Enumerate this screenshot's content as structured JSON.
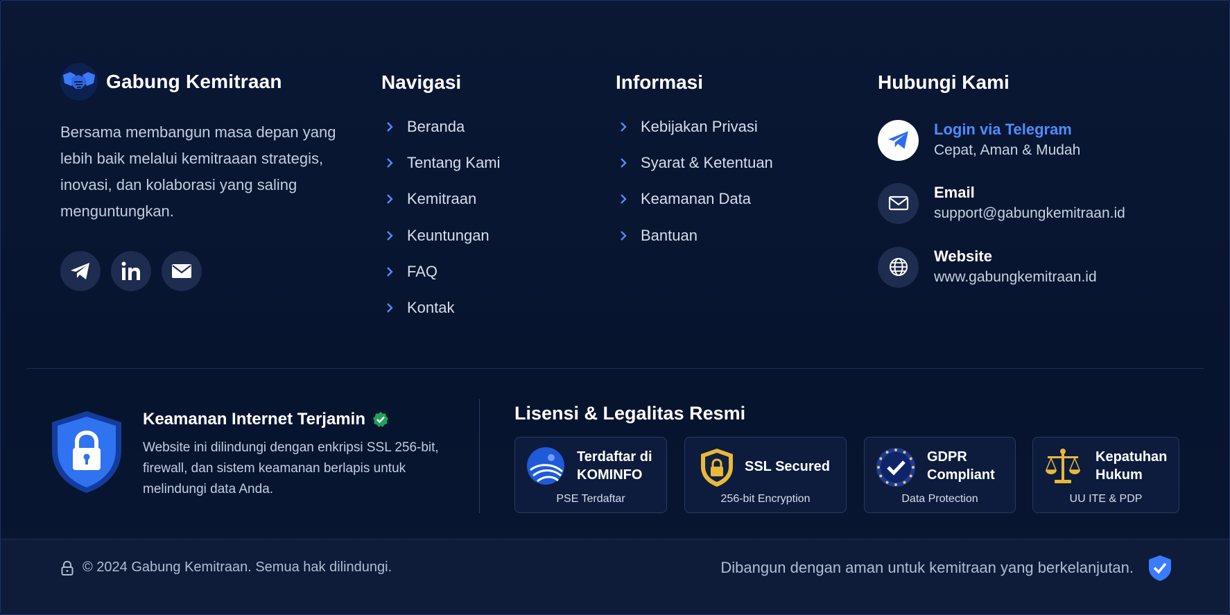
{
  "brand": {
    "name": "Gabung Kemitraan",
    "description": "Bersama membangun masa depan yang lebih baik melalui kemitraaan strategis, inovasi, dan kolaborasi yang saling menguntungkan.",
    "social": [
      "telegram-icon",
      "linkedin-icon",
      "mail-icon"
    ]
  },
  "navigasi": {
    "title": "Navigasi",
    "items": [
      {
        "label": "Beranda"
      },
      {
        "label": "Tentang Kami"
      },
      {
        "label": "Kemitraan"
      },
      {
        "label": "Keuntungan"
      },
      {
        "label": "FAQ"
      },
      {
        "label": "Kontak"
      }
    ]
  },
  "informasi": {
    "title": "Informasi",
    "items": [
      {
        "label": "Kebijakan Privasi"
      },
      {
        "label": "Syarat & Ketentuan"
      },
      {
        "label": "Keamanan Data"
      },
      {
        "label": "Bantuan"
      }
    ]
  },
  "contact": {
    "title": "Hubungi Kami",
    "telegram": {
      "label": "Login via Telegram",
      "value": "Cepat, Aman & Mudah"
    },
    "email": {
      "label": "Email",
      "value": "support@gabungkemitraan.id"
    },
    "website": {
      "label": "Website",
      "value": "www.gabungkemitraan.id"
    }
  },
  "security": {
    "title": "Keamanan Internet Terjamin",
    "description": "Website ini dilindungi dengan enkripsi SSL 256-bit, firewall, dan sistem keamanan berlapis untuk melindungi data Anda."
  },
  "licenses": {
    "title": "Lisensi & Legalitas Resmi",
    "badges": [
      {
        "title": "Terdaftar di KOMINFO",
        "subtitle": "PSE Terdaftar",
        "icon": "kominfo-logo"
      },
      {
        "title": "SSL Secured",
        "subtitle": "256-bit Encryption",
        "icon": "ssl-shield-icon"
      },
      {
        "title": "GDPR Compliant",
        "subtitle": "Data Protection",
        "icon": "gdpr-icon"
      },
      {
        "title": "Kepatuhan Hukum",
        "subtitle": "UU ITE & PDP",
        "icon": "scales-icon"
      }
    ]
  },
  "footer": {
    "copyright": "© 2024 Gabung Kemitraan. Semua hak dilindungi.",
    "built": "Dibangun dengan aman untuk kemitraan yang berkelanjutan."
  },
  "colors": {
    "background": "#07142e",
    "accent": "#4f8cff",
    "verified": "#22a05a",
    "gold": "#e8b93a"
  }
}
